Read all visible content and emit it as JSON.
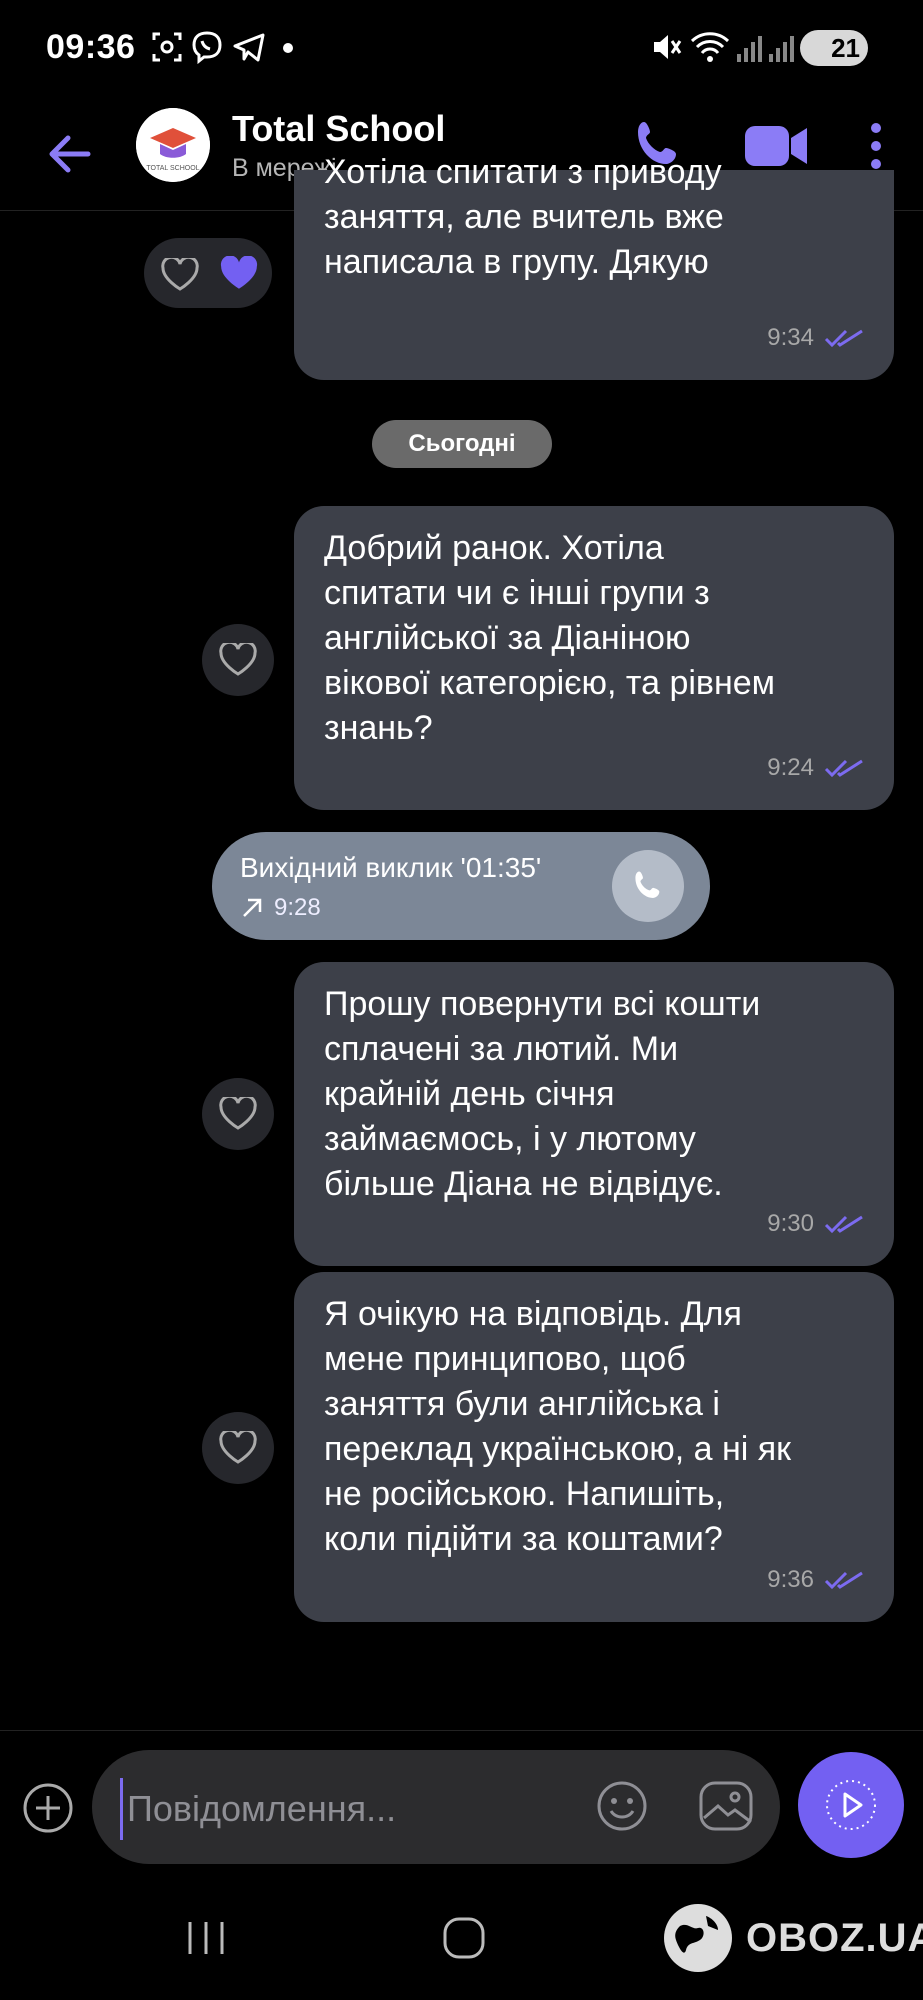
{
  "status_bar": {
    "time": "09:36",
    "battery": "21"
  },
  "header": {
    "name": "Total School",
    "status": "В мережі",
    "avatar_text": "TOTAL SCHOOL"
  },
  "messages": [
    {
      "text": "Хотіла спитати з приводу\nзаняття, але вчитель вже\nнаписала в групу. Дякую",
      "time": "9:34"
    },
    {
      "text": "Добрий ранок. Хотіла\nспитати чи є інші групи з\nанглійської за Діаніною\nвікової категорією, та рівнем\nзнань?",
      "time": "9:24"
    },
    {
      "text": "Прошу повернути всі кошти\nсплачені за лютий. Ми\nкрайній день січня\nзаймаємось, і у лютому\nбільше Діана не відвідує.",
      "time": "9:30"
    },
    {
      "text": "Я очікую на відповідь. Для\nмене принципово, щоб\nзаняття були англійська і\nпереклад українською, а ні як\nне російською. Напишіть,\nколи підійти за коштами?",
      "time": "9:36"
    }
  ],
  "date_divider": "Сьогодні",
  "call": {
    "title": "Вихідний виклик '01:35'",
    "time": "9:28"
  },
  "composer": {
    "placeholder": "Повідомлення..."
  },
  "watermark": "OBOZ.UA",
  "colors": {
    "accent": "#7360f2",
    "bubble": "#3d4049",
    "background": "#000000"
  }
}
